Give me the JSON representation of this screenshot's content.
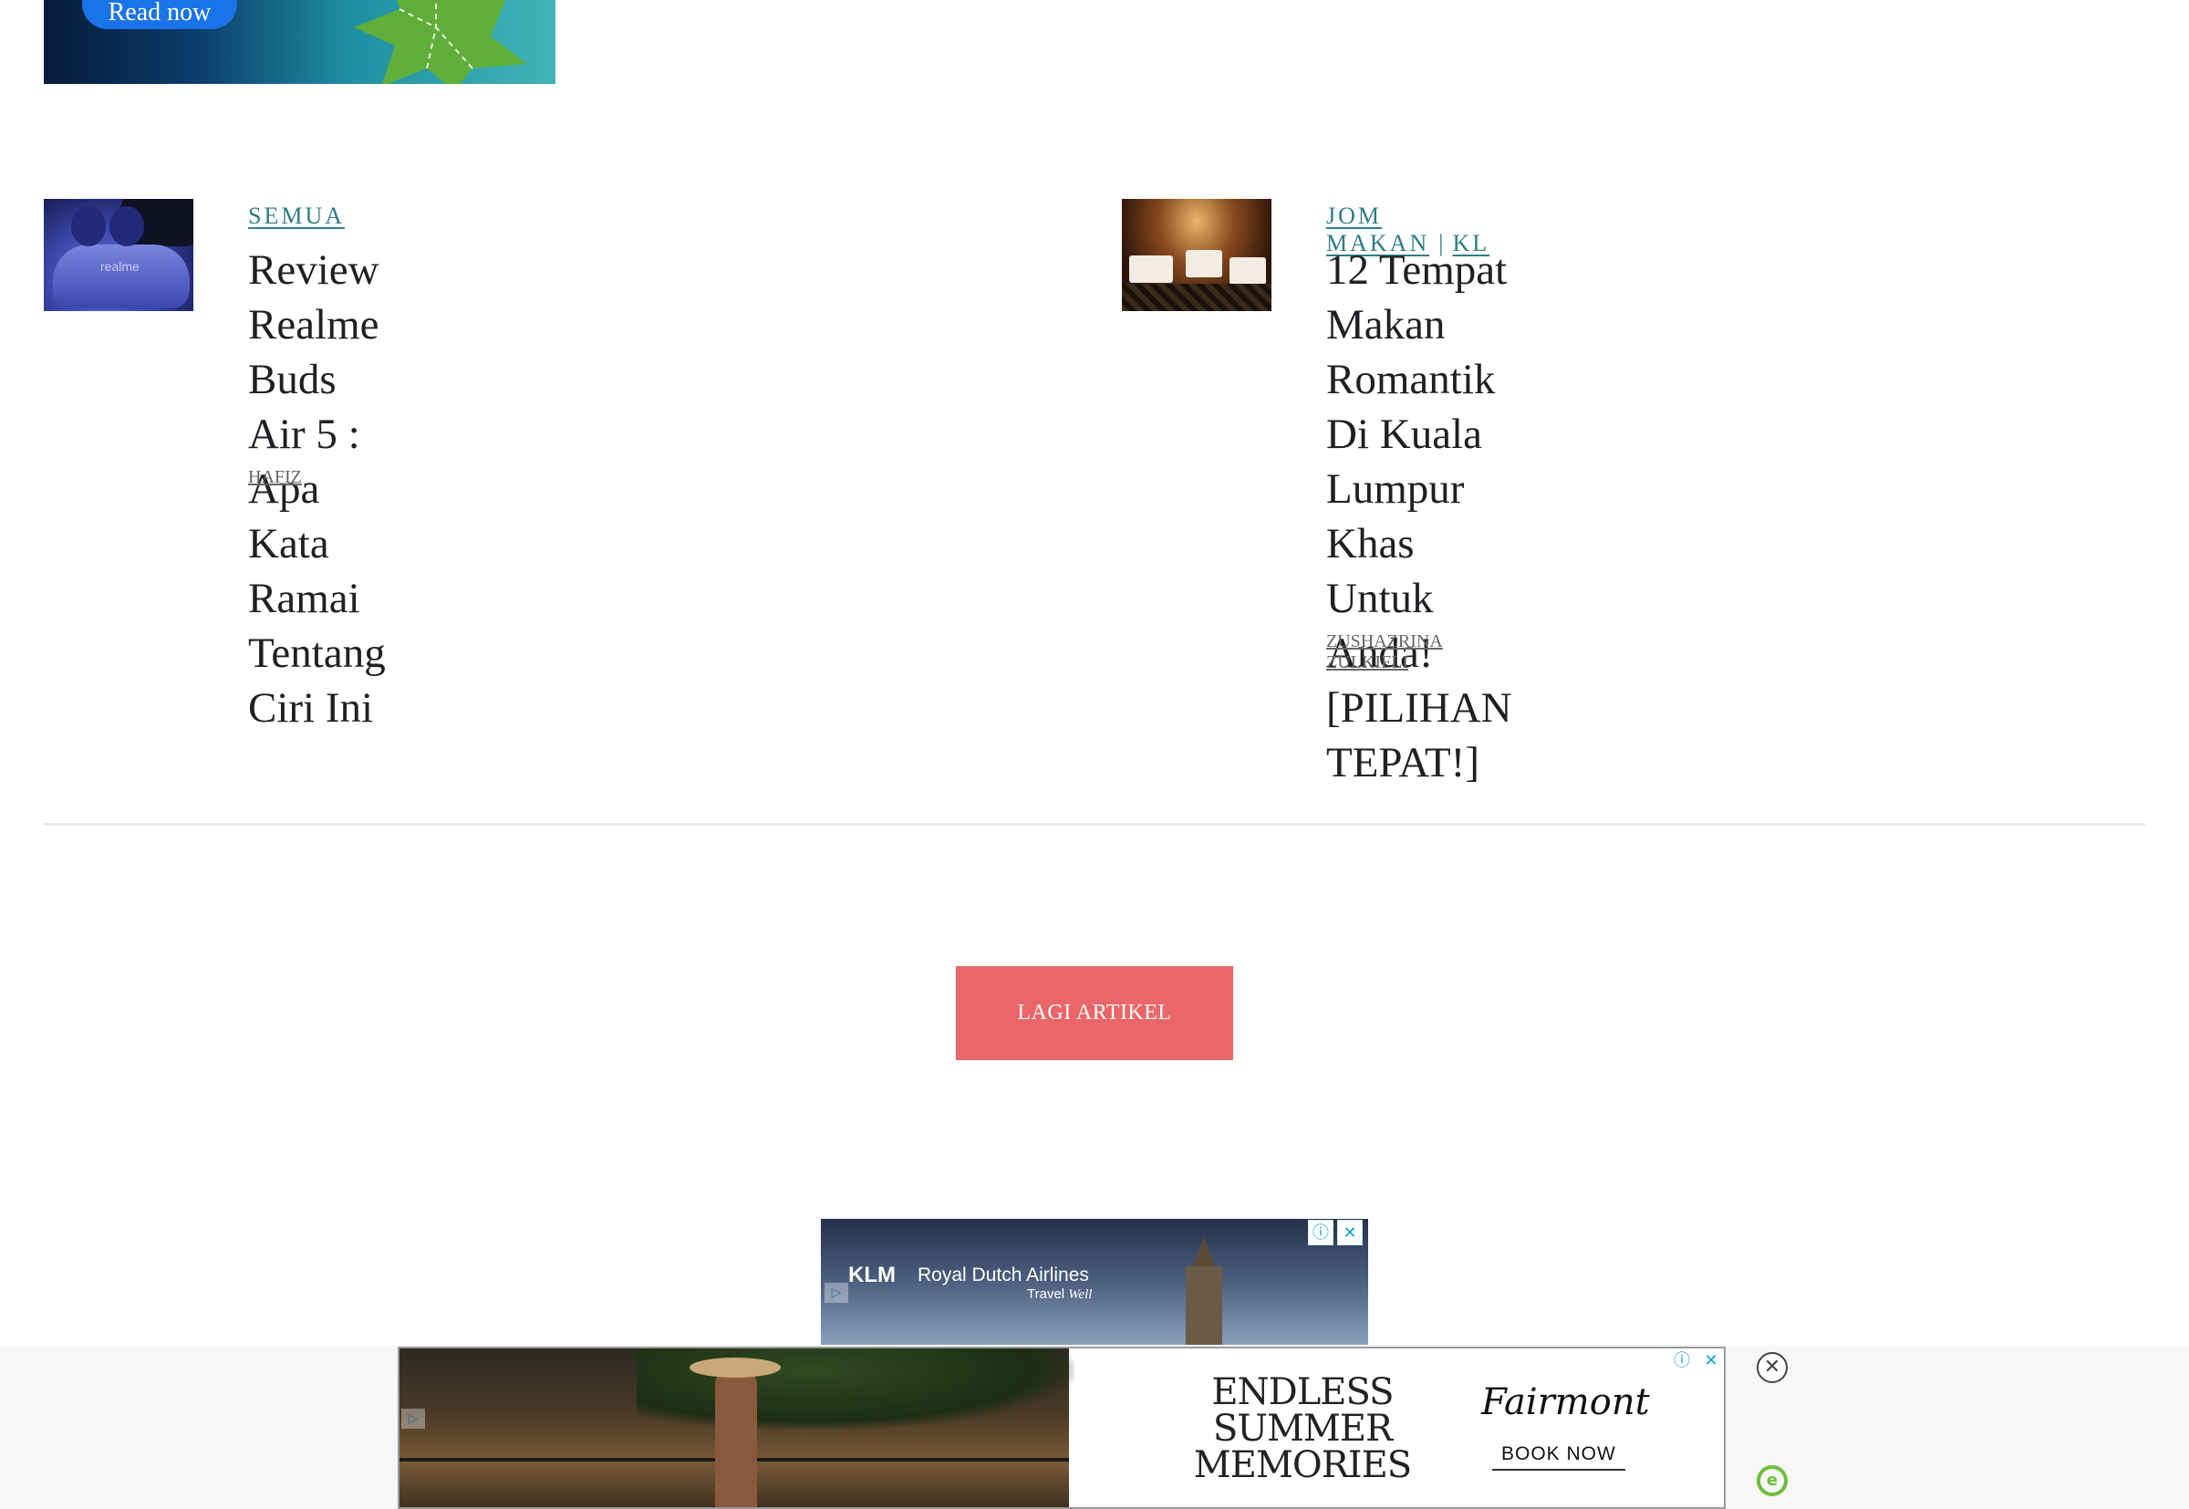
{
  "top_ad": {
    "button_label": "Read now"
  },
  "articles": [
    {
      "categories": [
        "SEMUA"
      ],
      "title": "Review Realme Buds Air 5 : Apa Kata Ramai Tentang Ciri Ini",
      "title_lines": [
        "Review Realme",
        "Buds Air 5 : Apa",
        "Kata Ramai",
        "Tentang Ciri Ini"
      ],
      "author": "HAFIZ",
      "thumb_brand": "realme"
    },
    {
      "categories": [
        "JOM MAKAN",
        "KL"
      ],
      "separator": "|",
      "title": "12 Tempat Makan Romantik Di Kuala Lumpur Khas Untuk Anda! [PILIHAN TEPAT!]",
      "title_lines": [
        "12 Tempat",
        "Makan Romantik",
        "Di Kuala",
        "Lumpur Khas",
        "Untuk Anda!",
        "[PILIHAN",
        "TEPAT!]"
      ],
      "author": "ZUSHAZRINA ZULKIFLI"
    }
  ],
  "more_button": {
    "label": "LAGI ARTIKEL"
  },
  "mid_ad": {
    "logo": "KLM",
    "brand": "Royal Dutch Airlines",
    "tagline_a": "Travel",
    "tagline_b": "Well",
    "info_icon": "ⓘ",
    "close_icon": "✕",
    "adchoices_icon": "▷"
  },
  "bottom_ad": {
    "headline_lines": [
      "ENDLESS",
      "SUMMER",
      "MEMORIES"
    ],
    "brand": "Fairmont",
    "cta": "BOOK NOW",
    "info_icon": "ⓘ",
    "close_icon": "✕",
    "adchoices_icon": "▷"
  },
  "sticky_close_icon": "✕",
  "sticky_logo": "e",
  "colors": {
    "accent_teal": "#2d7d86",
    "button_red": "#eb6668",
    "title_text": "#1f1f24"
  }
}
